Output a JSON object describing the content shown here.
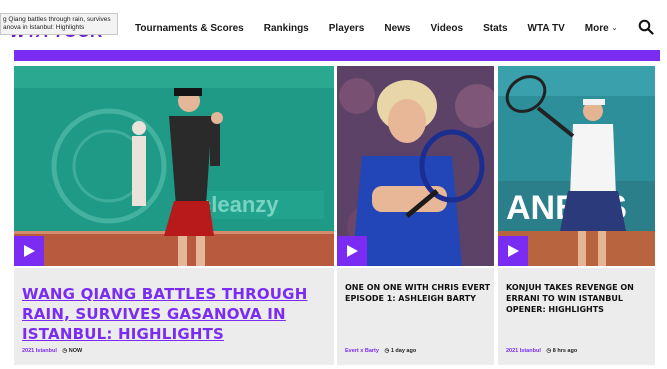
{
  "tooltip": "g Qiang battles through rain, survives anova in Istanbul: Highlights",
  "logo": {
    "text": "WTA TOUR"
  },
  "nav": {
    "items": [
      {
        "label": "Tournaments & Scores"
      },
      {
        "label": "Rankings"
      },
      {
        "label": "Players"
      },
      {
        "label": "News"
      },
      {
        "label": "Videos"
      },
      {
        "label": "Stats"
      },
      {
        "label": "WTA TV"
      }
    ],
    "more_label": "More"
  },
  "colors": {
    "accent": "#7b2cf2",
    "card_bg": "#ececec"
  },
  "cards": [
    {
      "headline": "WANG QIANG BATTLES THROUGH RAIN, SURVIVES GASANOVA IN ISTANBUL: HIGHLIGHTS",
      "tag": "2021 Istanbul",
      "time": "NOW"
    },
    {
      "headline": "ONE ON ONE WITH CHRIS EVERT EPISODE 1: ASHLEIGH BARTY",
      "tag": "Evert x Barty",
      "time": "1 day ago"
    },
    {
      "headline": "KONJUH TAKES REVENGE ON ERRANI TO WIN ISTANBUL OPENER: HIGHLIGHTS",
      "tag": "2021 Istanbul",
      "time": "8 hrs ago"
    }
  ]
}
